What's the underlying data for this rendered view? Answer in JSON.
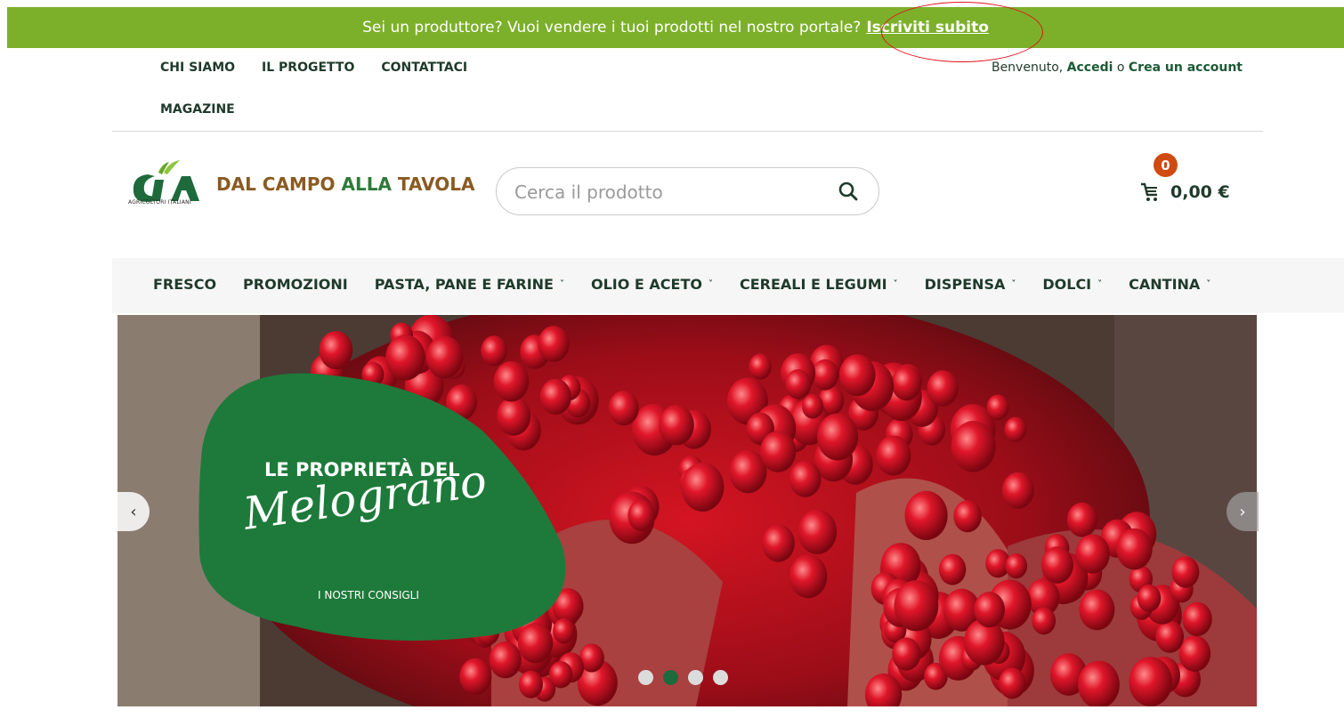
{
  "promo": {
    "text": "Sei un produttore? Vuoi vendere i tuoi prodotti nel nostro portale?",
    "link_label": "Iscriviti subito",
    "bg_color": "#7cb02a"
  },
  "top_nav": {
    "items": [
      {
        "label": "CHI SIAMO"
      },
      {
        "label": "IL PROGETTO"
      },
      {
        "label": "CONTATTACI"
      }
    ],
    "magazine_label": "MAGAZINE"
  },
  "account": {
    "welcome": "Benvenuto,",
    "login_label": "Accedi",
    "or_label": "o",
    "register_label": "Crea un account"
  },
  "header": {
    "logo_mark": "CIA",
    "logo_sub": "AGRICOLTORI ITALIANI",
    "brand_part1": "DAL CAMPO",
    "brand_part2": "ALLA",
    "brand_part3": "TAVOLA",
    "search_placeholder": "Cerca il prodotto",
    "search_icon": "search-icon",
    "cart_count": "0",
    "cart_total": "0,00 €",
    "cart_icon": "cart-icon"
  },
  "categories": [
    {
      "label": "FRESCO",
      "has_dropdown": false
    },
    {
      "label": "PROMOZIONI",
      "has_dropdown": false
    },
    {
      "label": "PASTA, PANE E FARINE",
      "has_dropdown": true
    },
    {
      "label": "OLIO E ACETO",
      "has_dropdown": true
    },
    {
      "label": "CEREALI E LEGUMI",
      "has_dropdown": true
    },
    {
      "label": "DISPENSA",
      "has_dropdown": true
    },
    {
      "label": "DOLCI",
      "has_dropdown": true
    },
    {
      "label": "CANTINA",
      "has_dropdown": true
    }
  ],
  "hero": {
    "line1": "LE PROPRIETÀ DEL",
    "line2": "Melograno",
    "line3": "I NOSTRI CONSIGLI",
    "prev_icon": "chevron-left-icon",
    "next_icon": "chevron-right-icon",
    "slide_count": 4,
    "active_slide": 2,
    "blob_color": "#1e7a3a"
  },
  "colors": {
    "accent_green": "#7cb02a",
    "dark_green": "#1e6a3c",
    "brand_brown": "#8a5a22",
    "badge_orange": "#d04a12"
  }
}
